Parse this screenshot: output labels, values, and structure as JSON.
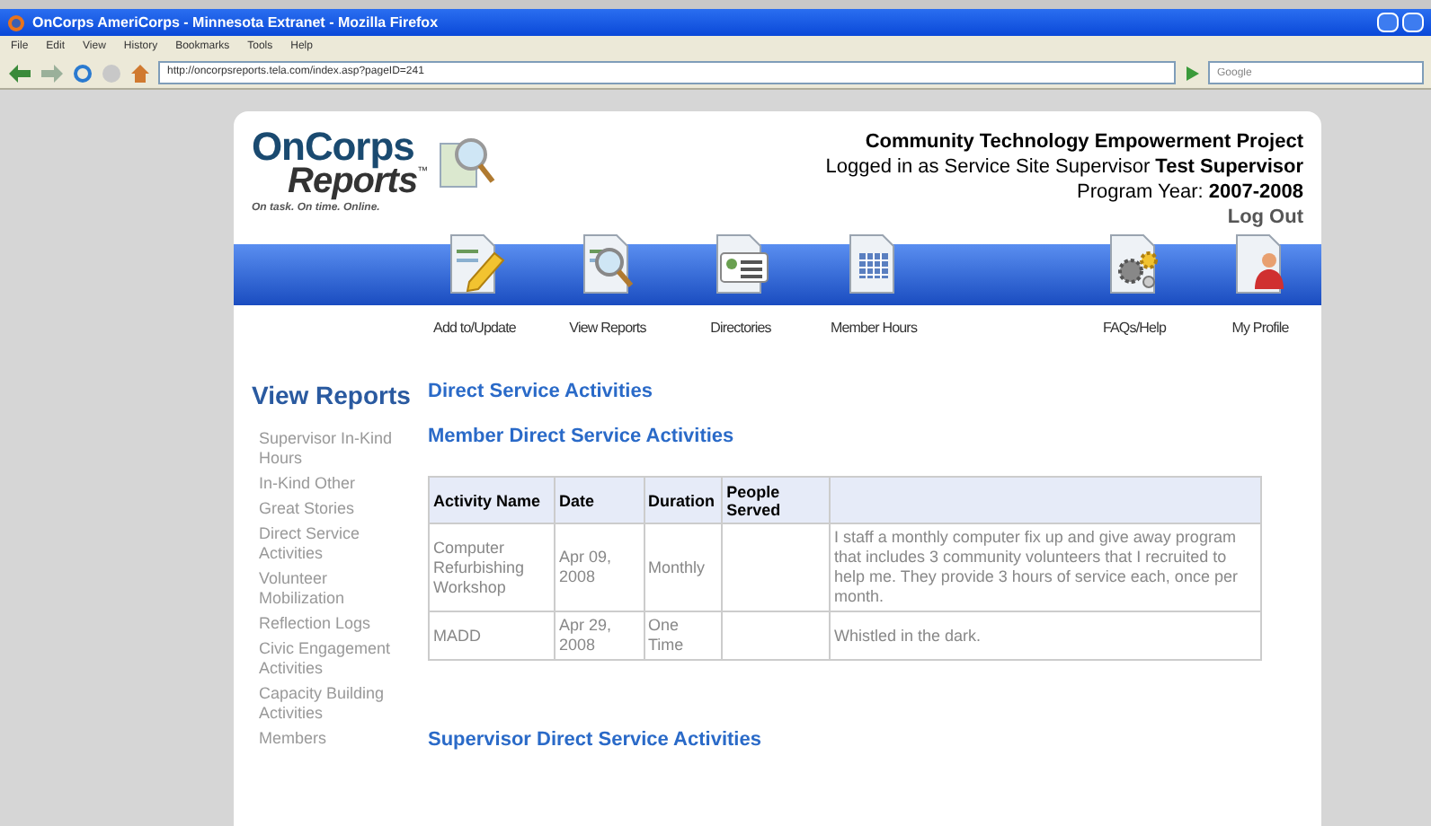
{
  "window": {
    "title": "OnCorps AmeriCorps - Minnesota Extranet - Mozilla Firefox"
  },
  "menu": [
    "File",
    "Edit",
    "View",
    "History",
    "Bookmarks",
    "Tools",
    "Help"
  ],
  "toolbar": {
    "url": "http://oncorpsreports.tela.com/index.asp?pageID=241",
    "search_placeholder": "Google"
  },
  "logo": {
    "line1": "OnCorps",
    "line2": "Reports",
    "tm": "™",
    "tagline": "On task. On time. Online."
  },
  "header": {
    "project": "Community Technology Empowerment Project",
    "logged_in": "Logged in as Service Site Supervisor **Test Supervisor**",
    "program_year": "Program Year: **2007-2008**",
    "logout": "Log Out"
  },
  "nav": {
    "left": [
      {
        "label": "Add to/Update",
        "kind": "pencil"
      },
      {
        "label": "View Reports",
        "kind": "magnifier"
      },
      {
        "label": "Directories",
        "kind": "directory"
      },
      {
        "label": "Member Hours",
        "kind": "grid"
      }
    ],
    "right": [
      {
        "label": "FAQs/Help",
        "kind": "gears"
      },
      {
        "label": "My Profile",
        "kind": "person"
      }
    ]
  },
  "sidebar": {
    "title": "View Reports",
    "items": [
      "Supervisor In-Kind Hours",
      "In-Kind Other",
      "Great Stories",
      "Direct Service Activities",
      "Volunteer Mobilization",
      "Reflection Logs",
      "Civic Engagement Activities",
      "Capacity Building Activities",
      "Members"
    ]
  },
  "content": {
    "title": "Direct Service Activities",
    "member_heading": "Member Direct Service Activities",
    "table": {
      "columns": [
        "Activity Name",
        "Date",
        "Duration",
        "People Served"
      ],
      "rows": [
        {
          "activity_name": "Computer Refurbishing Workshop",
          "date": "Apr 09, 2008",
          "duration": "Monthly",
          "people_served": "",
          "column_5": "I staff a monthly computer fix up and give away program that includes 3 community volunteers that I recruited to help me. They provide 3 hours of service each, once per month."
        },
        {
          "activity_name": "MADD",
          "date": "Apr 29, 2008",
          "duration": "One Time",
          "people_served": "",
          "column_5": "Whistled in the dark."
        }
      ]
    },
    "supervisor_heading": "Supervisor Direct Service Activities"
  }
}
